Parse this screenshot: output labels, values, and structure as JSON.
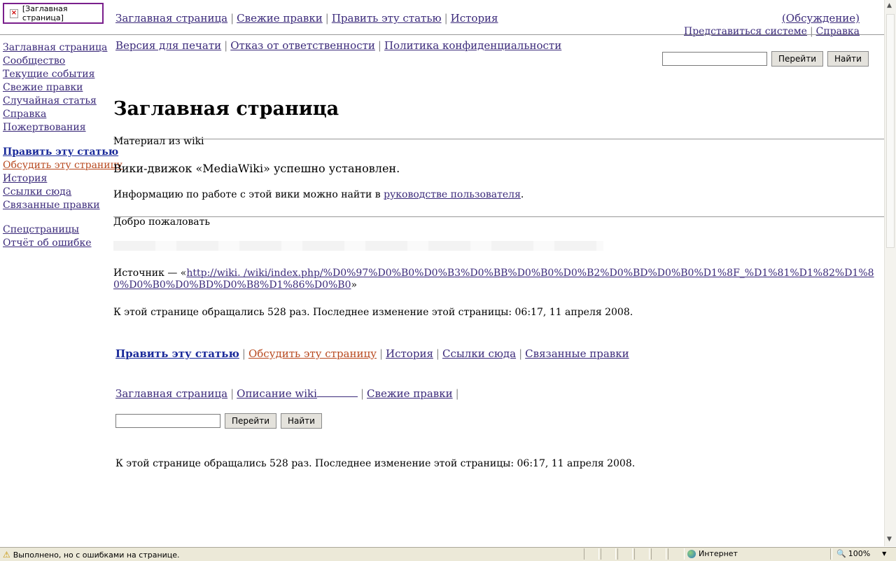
{
  "logo": {
    "alt_text": "[Заглавная страница]",
    "icon": "broken-image-icon"
  },
  "top_nav": {
    "links": [
      "Заглавная страница",
      "Свежие правки",
      "Править эту статью",
      "История"
    ],
    "discussion": "(Обсуждение)",
    "login": "Представиться системе",
    "help": "Справка"
  },
  "sub_nav": [
    "Версия для печати",
    "Отказ от ответственности",
    "Политика конфиденциальности"
  ],
  "search": {
    "value": "",
    "go_label": "Перейти",
    "find_label": "Найти"
  },
  "sidebar": {
    "navigation": [
      "Заглавная страница",
      "Сообщество",
      "Текущие события",
      "Свежие правки",
      "Случайная статья",
      "Справка",
      "Пожертвования"
    ],
    "page_actions": [
      "Править эту статью",
      "Обсудить эту страницу",
      "История",
      "Ссылки сюда",
      "Связанные правки"
    ],
    "tools": [
      "Спецстраницы",
      "Отчёт об ошибке"
    ]
  },
  "content": {
    "title": "Заглавная страница",
    "from": "Материал из wiki",
    "installed": "Вики-движок «MediaWiki» успешно установлен.",
    "info_prefix": "Информацию по работе с этой вики можно найти в ",
    "info_link": "руководстве пользователя",
    "info_suffix": ".",
    "welcome": "Добро пожаловать",
    "source_prefix": "Источник — «",
    "source_url": "http://wiki.            /wiki/index.php/%D0%97%D0%B0%D0%B3%D0%BB%D0%B0%D0%B2%D0%BD%D0%B0%D1%8F_%D1%81%D1%82%D1%80%D0%B0%D0%BD%D0%B8%D1%86%D0%B0",
    "source_suffix": "»",
    "stats": "К этой странице обращались 528 раз. Последнее изменение этой страницы: 06:17, 11 апреля 2008."
  },
  "bottom_actions": [
    "Править эту статью",
    "Обсудить эту страницу",
    "История",
    "Ссылки сюда",
    "Связанные правки"
  ],
  "footer_links": [
    "Заглавная страница",
    "Описание wiki",
    "Свежие правки"
  ],
  "footer_stats": "К этой странице обращались 528 раз. Последнее изменение этой страницы: 06:17, 11 апреля 2008.",
  "statusbar": {
    "text": "Выполнено, но с ошибками на странице.",
    "zone": "Интернет",
    "zoom": "100%"
  }
}
